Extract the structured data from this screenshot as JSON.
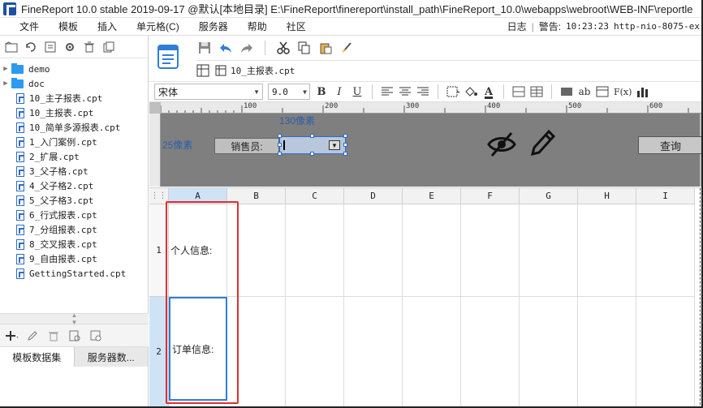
{
  "titlebar": {
    "title": "FineReport 10.0 stable 2019-09-17 @默认[本地目录]    E:\\FineReport\\finereport\\install_path\\FineReport_10.0\\webapps\\webroot\\WEB-INF\\reportle"
  },
  "menubar": {
    "items": [
      "文件",
      "模板",
      "插入",
      "单元格(C)",
      "服务器",
      "帮助",
      "社区"
    ],
    "log_label": "日志",
    "alarm_label": "警告:",
    "alarm_time": "10:23:23",
    "alarm_text": "http-nio-8075-ex"
  },
  "tree": {
    "folders": [
      "demo",
      "doc"
    ],
    "files": [
      "10_主子报表.cpt",
      "10_主报表.cpt",
      "10_简单多源报表.cpt",
      "1_入门案例.cpt",
      "2_扩展.cpt",
      "3_父子格.cpt",
      "4_父子格2.cpt",
      "5_父子格3.cpt",
      "6_行式报表.cpt",
      "7_分组报表.cpt",
      "8_交叉报表.cpt",
      "9_自由报表.cpt",
      "GettingStarted.cpt"
    ]
  },
  "left_tabs": {
    "template_dataset": "模板数据集",
    "server_dataset": "服务器数..."
  },
  "doc_tab": {
    "label": "10_主报表.cpt"
  },
  "format": {
    "font": "宋体",
    "size": "9.0",
    "bold": "B",
    "italic": "I",
    "underline": "U",
    "text_btn": "ab",
    "formula_btn": "F(x)"
  },
  "ruler": {
    "marks": [
      "100",
      "200",
      "300",
      "400",
      "500",
      "600"
    ]
  },
  "param_panel": {
    "width_hint": "130像素",
    "height_hint": "25像素",
    "label": "销售员:",
    "query_button": "查询"
  },
  "grid": {
    "columns": [
      "A",
      "B",
      "C",
      "D",
      "E",
      "F",
      "G",
      "H",
      "I"
    ],
    "rows": [
      {
        "num": "1",
        "a": "个人信息:"
      },
      {
        "num": "2",
        "a": "订单信息:"
      }
    ]
  }
}
